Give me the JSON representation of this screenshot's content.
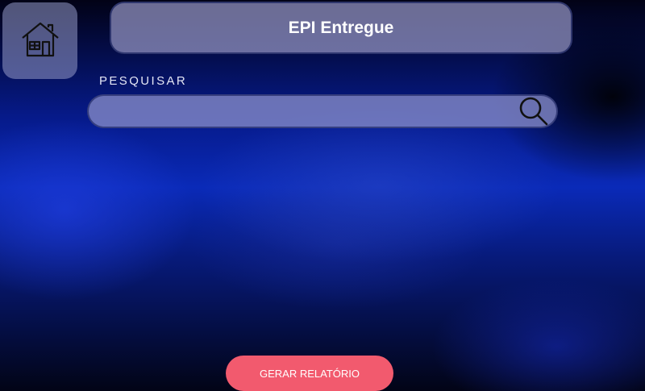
{
  "header": {
    "home_icon": "house-icon",
    "title": "EPI Entregue"
  },
  "search": {
    "label": "PESQUISAR",
    "value": "",
    "placeholder": "",
    "icon": "magnifier-icon"
  },
  "actions": {
    "report_label": "GERAR RELATÓRIO"
  },
  "colors": {
    "background_accent": "#0a2ab8",
    "report_button": "#f25a6e",
    "panel": "#9a9ac8"
  }
}
